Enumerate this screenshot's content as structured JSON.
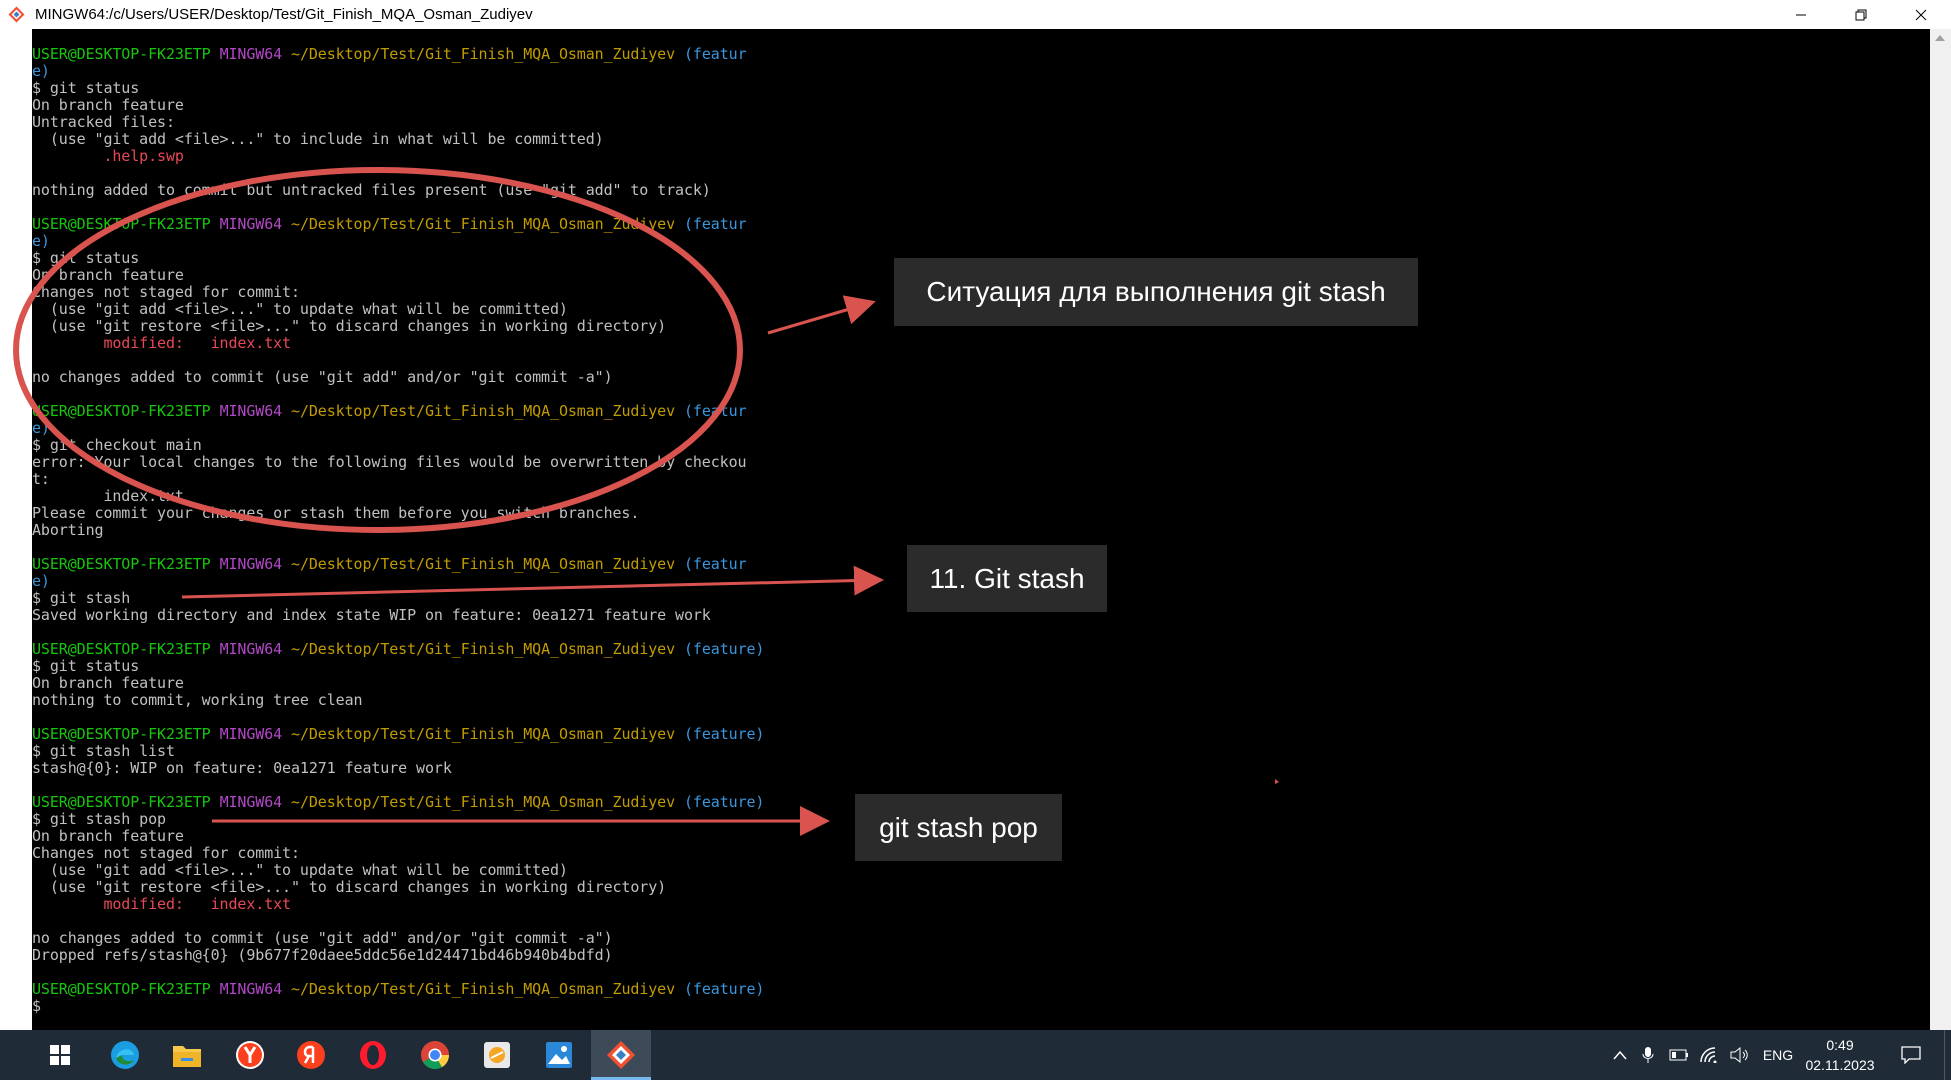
{
  "window": {
    "title": "MINGW64:/c/Users/USER/Desktop/Test/Git_Finish_MQA_Osman_Zudiyev",
    "minimize_icon": "minimize-icon",
    "restore_icon": "restore-icon",
    "close_icon": "close-icon"
  },
  "prompt": {
    "user": "USER@DESKTOP-FK23ETP",
    "host": "MINGW64",
    "path": "~/Desktop/Test/Git_Finish_MQA_Osman_Zudiyev",
    "branch_wrapped_start": "(featur",
    "branch_wrapped_end": "e)",
    "branch": "(feature)"
  },
  "terminal": {
    "b1_cmd": "$ git status",
    "b1_l1": "On branch feature",
    "b1_l2": "Untracked files:",
    "b1_l3": "  (use \"git add <file>...\" to include in what will be committed)",
    "b1_l4": "        .help.swp",
    "b1_l5": "nothing added to commit but untracked files present (use \"git add\" to track)",
    "b2_cmd": "$ git status",
    "b2_l1": "On branch feature",
    "b2_l2": "Changes not staged for commit:",
    "b2_l3": "  (use \"git add <file>...\" to update what will be committed)",
    "b2_l4": "  (use \"git restore <file>...\" to discard changes in working directory)",
    "b2_l5": "        modified:   index.txt",
    "b2_l6": "no changes added to commit (use \"git add\" and/or \"git commit -a\")",
    "b3_cmd": "$ git checkout main",
    "b3_l1": "error: Your local changes to the following files would be overwritten by checkou",
    "b3_l2": "t:",
    "b3_l3": "        index.txt",
    "b3_l4": "Please commit your changes or stash them before you switch branches.",
    "b3_l5": "Aborting",
    "b4_cmd": "$ git stash",
    "b4_l1": "Saved working directory and index state WIP on feature: 0ea1271 feature work",
    "b5_cmd": "$ git status",
    "b5_l1": "On branch feature",
    "b5_l2": "nothing to commit, working tree clean",
    "b6_cmd": "$ git stash list",
    "b6_l1": "stash@{0}: WIP on feature: 0ea1271 feature work",
    "b7_cmd": "$ git stash pop",
    "b7_l1": "On branch feature",
    "b7_l2": "Changes not staged for commit:",
    "b7_l3": "  (use \"git add <file>...\" to update what will be committed)",
    "b7_l4": "  (use \"git restore <file>...\" to discard changes in working directory)",
    "b7_l5": "        modified:   index.txt",
    "b7_l6": "no changes added to commit (use \"git add\" and/or \"git commit -a\")",
    "b7_l7": "Dropped refs/stash@{0} (9b677f20daee5ddc56e1d24471bd46b940b4bdfd)",
    "final_prompt": "$"
  },
  "annotations": {
    "label_situation": "Ситуация для выполнения git stash",
    "label_stash": "11. Git stash",
    "label_pop": "git stash pop",
    "color_annotation": "#d9534f"
  },
  "taskbar": {
    "start_icon": "windows-start-icon",
    "apps": [
      "edge-icon",
      "file-explorer-icon",
      "yandex-browser-icon",
      "yandex-icon",
      "opera-icon",
      "chrome-icon",
      "sublime-like-app-icon",
      "photos-icon",
      "git-bash-icon"
    ],
    "language": "ENG",
    "time": "0:49",
    "date": "02.11.2023"
  },
  "colors": {
    "prompt_user": "#16c60c",
    "prompt_host": "#b148c6",
    "prompt_path": "#c19c00",
    "prompt_branch": "#3a96dd",
    "error_red": "#e74856",
    "terminal_text": "#c0c0c0",
    "taskbar_bg": "#1f2b37"
  }
}
